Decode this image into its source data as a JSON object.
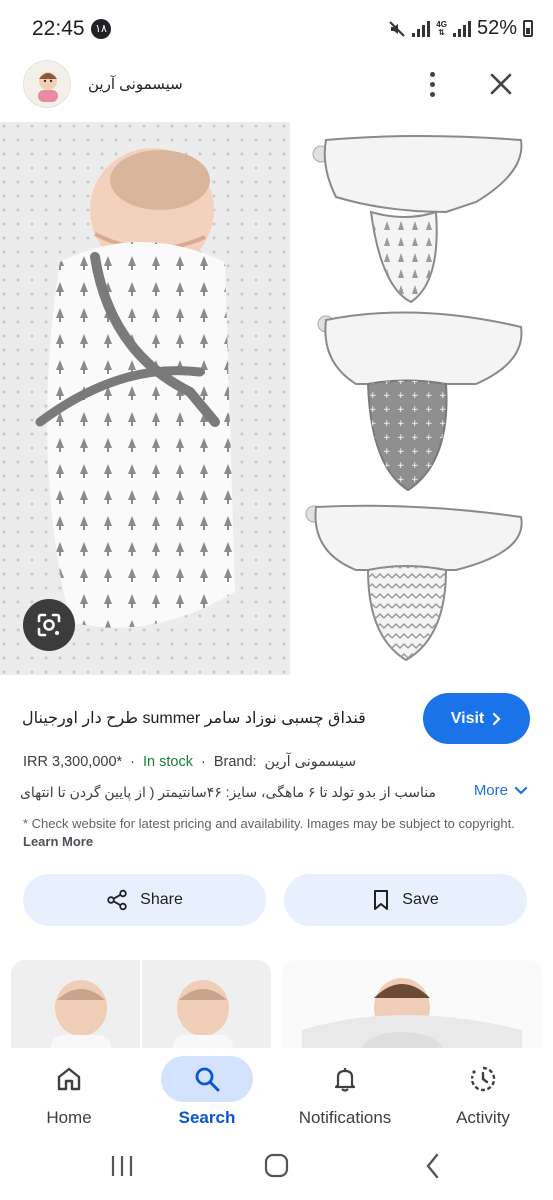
{
  "status_bar": {
    "time": "22:45",
    "notification_badge": "۱۸",
    "network": "4G",
    "battery": "52%"
  },
  "header": {
    "site_name": "سیسمونی آرین"
  },
  "image_viewer": {
    "lens_icon": "google-lens-icon"
  },
  "product": {
    "title": "قنداق چسبی نوزاد سامر summer طرح دار اورجینال",
    "visit_label": "Visit",
    "price": "IRR 3,300,000*",
    "stock": "In stock",
    "brand_label": "Brand:",
    "brand_value": "سیسمونی آرین",
    "description": "مناسب از بدو تولد تا ۶ ماهگی، سایز: ۴۶سانتیمتر ( از پایین گردن تا انتهای پا ...",
    "more_label": "More",
    "disclaimer": "* Check website for latest pricing and availability. Images may be subject to copyright.",
    "learn_more": "Learn More",
    "share_label": "Share",
    "save_label": "Save"
  },
  "bottom_nav": {
    "items": [
      {
        "label": "Home",
        "icon": "home-icon"
      },
      {
        "label": "Search",
        "icon": "search-icon",
        "active": true
      },
      {
        "label": "Notifications",
        "icon": "bell-icon"
      },
      {
        "label": "Activity",
        "icon": "history-icon"
      }
    ]
  },
  "colors": {
    "accent": "#1a73e8",
    "stock_green": "#188038",
    "pill_bg": "#e8f0fe"
  }
}
